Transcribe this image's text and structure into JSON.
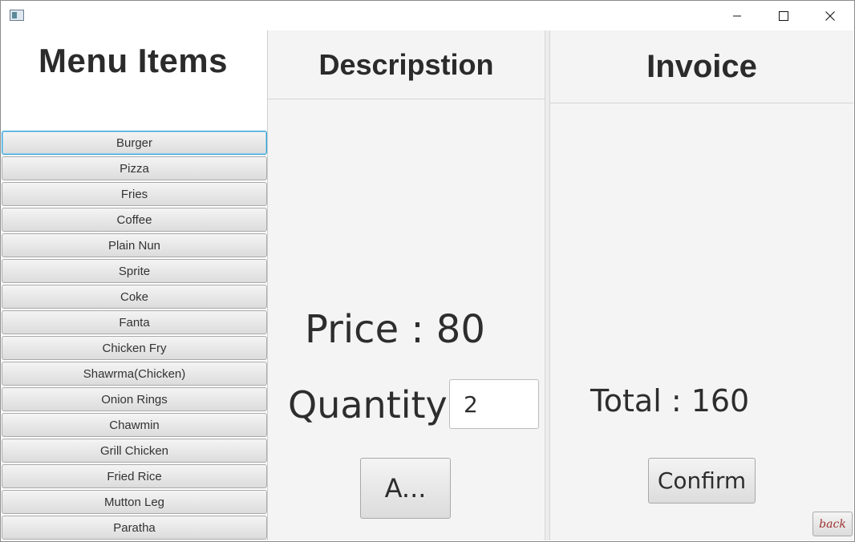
{
  "window": {
    "icons": {
      "app": "app-icon",
      "minimize": "minimize-icon",
      "maximize": "maximize-icon",
      "close": "close-icon"
    }
  },
  "menu": {
    "title": "Menu Items",
    "items": [
      {
        "label": "Burger"
      },
      {
        "label": "Pizza"
      },
      {
        "label": "Fries"
      },
      {
        "label": "Coffee"
      },
      {
        "label": "Plain Nun"
      },
      {
        "label": "Sprite"
      },
      {
        "label": "Coke"
      },
      {
        "label": "Fanta"
      },
      {
        "label": "Chicken Fry"
      },
      {
        "label": "Shawrma(Chicken)"
      },
      {
        "label": "Onion Rings"
      },
      {
        "label": "Chawmin"
      },
      {
        "label": "Grill Chicken"
      },
      {
        "label": "Fried Rice"
      },
      {
        "label": "Mutton Leg"
      },
      {
        "label": "Paratha"
      }
    ]
  },
  "description": {
    "title": "Descripstion",
    "price_text": "Price : 80",
    "quantity_label": "Quantity",
    "quantity_value": "2",
    "add_button_label": "A..."
  },
  "invoice": {
    "title": "Invoice",
    "total_text": "Total : 160",
    "confirm_label": "Confirm",
    "back_label": "back"
  },
  "colors": {
    "focus_border": "#2a9fd6",
    "pane_bg": "#f4f4f4",
    "back_text": "#a03030"
  }
}
